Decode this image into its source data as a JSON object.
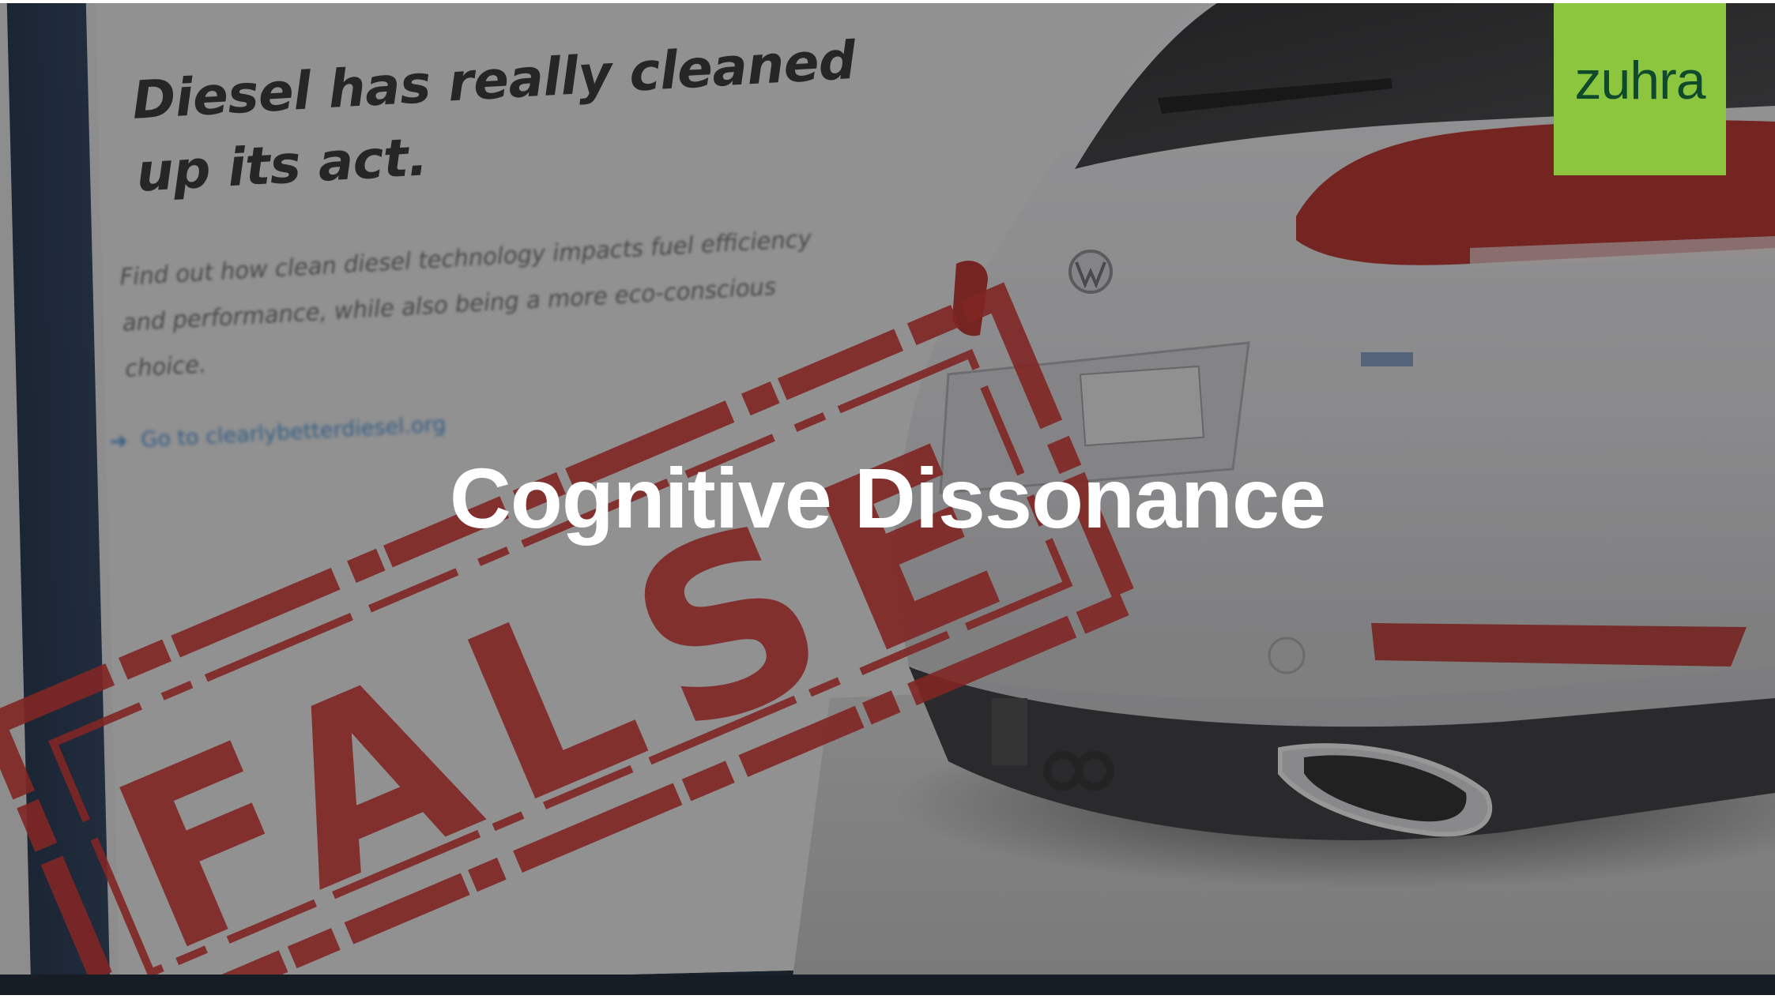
{
  "slide": {
    "title": "Cognitive Dissonance"
  },
  "logo": {
    "wordmark": "zuhra",
    "background_color": "#8cc63f",
    "text_color": "#0f4a2c"
  },
  "photo": {
    "headline_line1": "Diesel has really cleaned",
    "headline_line2": "up its act.",
    "body_text": "Find out how clean diesel technology impacts fuel efficiency and performance, while also being a more eco-conscious choice.",
    "link_text": "Go to clearlybetterdiesel.org",
    "stamp_text": "FALSE",
    "stamp_color": "#c8332f"
  }
}
